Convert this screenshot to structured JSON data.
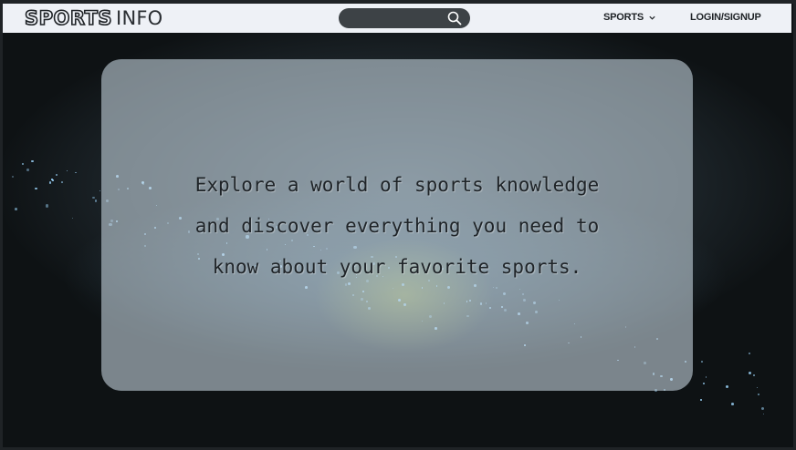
{
  "nav": {
    "logo_bold": "SPORTS",
    "logo_light": "INFO",
    "search_icon": "search-icon",
    "sports_label": "SPORTS",
    "sports_icon": "chevron-down-icon",
    "login_label": "LOGIN/SIGNUP"
  },
  "hero": {
    "line1": "Explore a world of sports knowledge",
    "line2": "and discover everything you need to",
    "line3": "know about your favorite sports."
  },
  "colors": {
    "navbar_bg": "#eef1f6",
    "search_bg": "#3d4246",
    "text_dark": "#1e2226",
    "card_bg": "rgba(190,205,215,0.62)"
  }
}
